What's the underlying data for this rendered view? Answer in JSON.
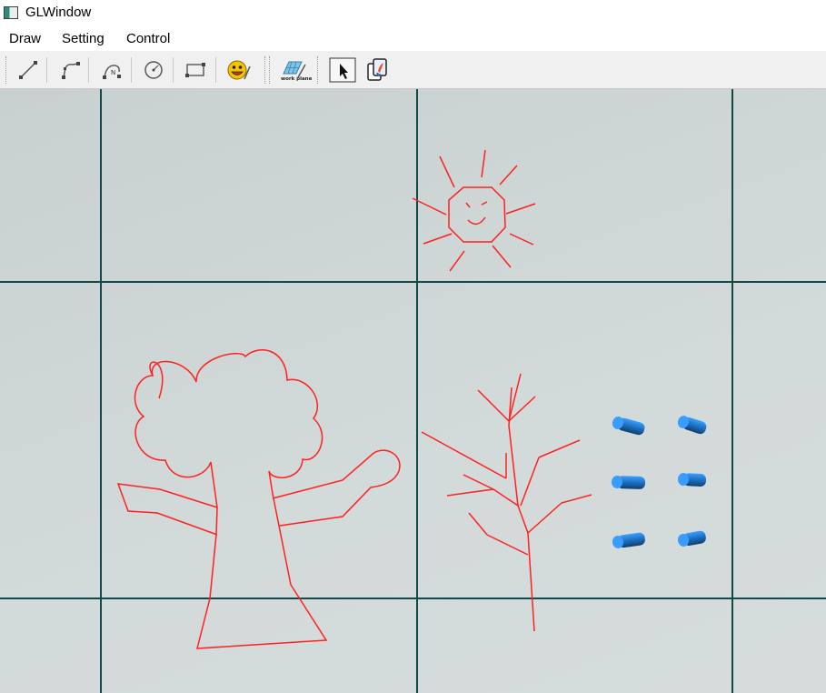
{
  "window": {
    "title": "GLWindow"
  },
  "menu": {
    "items": [
      "Draw",
      "Setting",
      "Control"
    ]
  },
  "toolbar": {
    "tools": [
      {
        "name": "line-tool",
        "icon": "line-icon"
      },
      {
        "name": "polyline-tool",
        "icon": "polyline-icon"
      },
      {
        "name": "curve-tool",
        "icon": "bezier-curve-icon"
      },
      {
        "name": "circle-tool",
        "icon": "circle-icon"
      },
      {
        "name": "rectangle-tool",
        "icon": "rectangle-icon"
      },
      {
        "name": "smiley-tool",
        "icon": "smiley-icon"
      },
      {
        "name": "work-plane-tool",
        "icon": "work-plane-icon",
        "label": "work plane"
      },
      {
        "name": "select-tool",
        "icon": "arrow-cursor-icon"
      },
      {
        "name": "copy-tool",
        "icon": "copy-icon"
      }
    ]
  },
  "canvas": {
    "background": "#d0d6d6",
    "grid_color": "#0f4a48",
    "stroke_color": "#ff2020",
    "cylinder_color": "#1e7fd8"
  }
}
